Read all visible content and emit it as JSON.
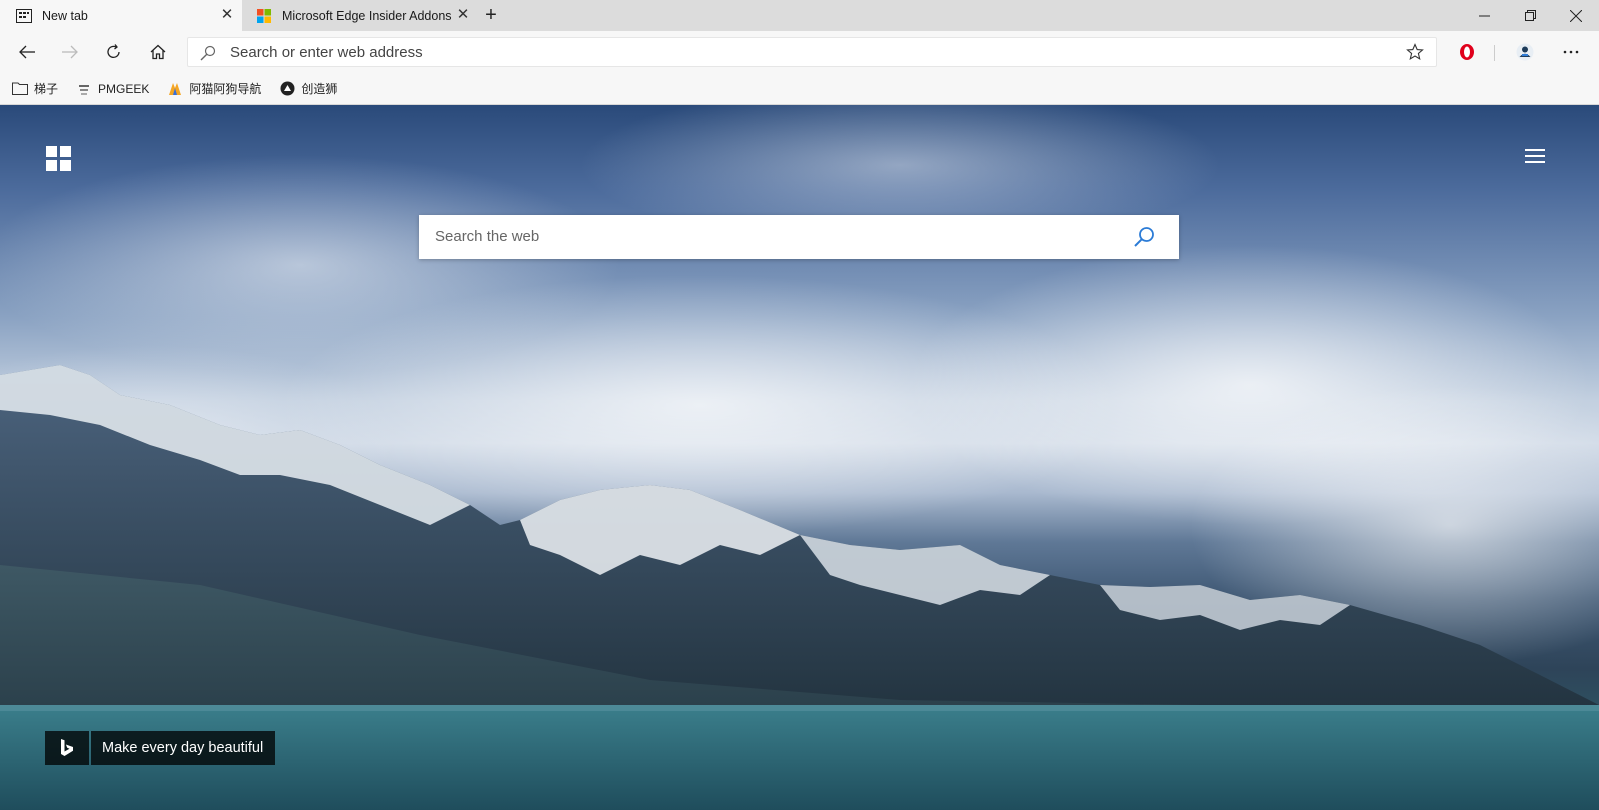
{
  "tabs": [
    {
      "label": "New tab",
      "icon": "new-tab-page-icon",
      "active": true
    },
    {
      "label": "Microsoft Edge Insider Addons",
      "icon": "microsoft-logo-icon",
      "active": false
    }
  ],
  "window_controls": {
    "minimize": "—",
    "restore": "❐",
    "close": "✕"
  },
  "toolbar": {
    "address_placeholder": "Search or enter web address"
  },
  "favorites": [
    {
      "label": "梯子",
      "icon": "folder-icon"
    },
    {
      "label": "PMGEEK",
      "icon": "pmgeek-icon"
    },
    {
      "label": "阿猫阿狗导航",
      "icon": "amao-agou-icon"
    },
    {
      "label": "创造狮",
      "icon": "chuangzaoshi-icon"
    }
  ],
  "newtab": {
    "search_placeholder": "Search the web",
    "bing_caption": "Make every day beautiful"
  },
  "colors": {
    "opera_red": "#e0001b",
    "bing_blue": "#2b7bd6"
  }
}
